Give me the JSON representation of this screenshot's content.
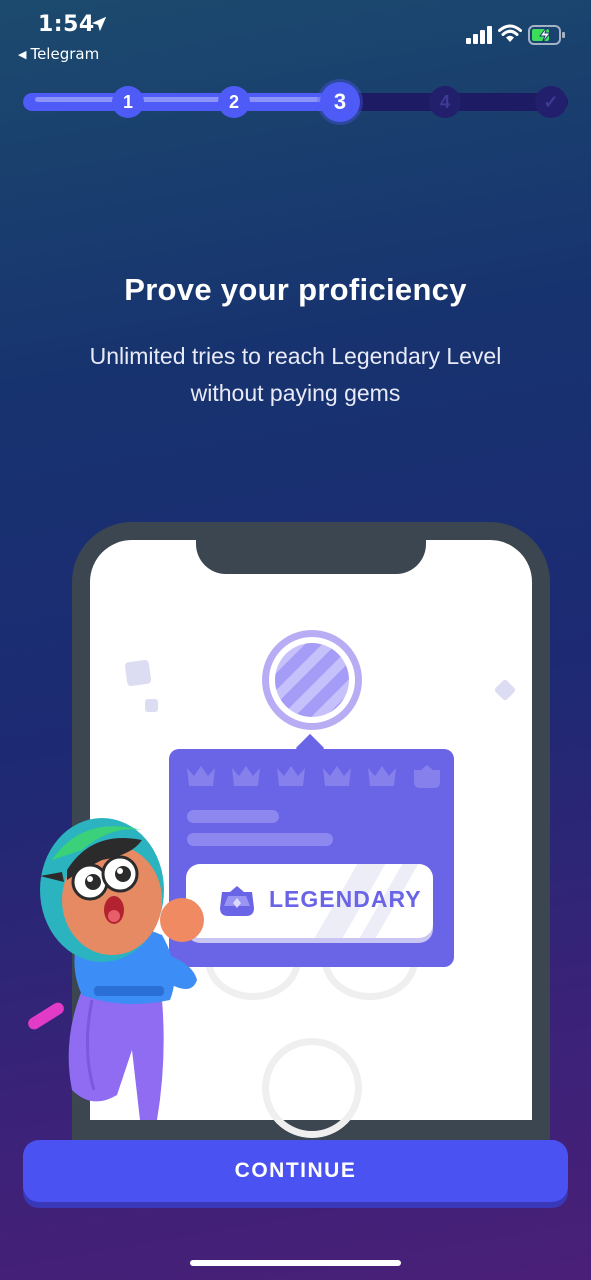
{
  "status_bar": {
    "time": "1:54",
    "back_app": "Telegram",
    "back_arrow": "◀",
    "icons": [
      "location-arrow-icon",
      "signal-icon",
      "wifi-icon",
      "battery-charging-icon"
    ]
  },
  "progress": {
    "current_step": 3,
    "steps": [
      {
        "label": "1",
        "state": "done"
      },
      {
        "label": "2",
        "state": "done"
      },
      {
        "label": "3",
        "state": "current"
      },
      {
        "label": "4",
        "state": "todo"
      },
      {
        "label": "✓",
        "state": "todo"
      }
    ]
  },
  "content": {
    "title": "Prove your proficiency",
    "subtitle_line1": "Unlimited tries to reach Legendary Level",
    "subtitle_line2": "without paying gems"
  },
  "illustration": {
    "badge_label": "LEGENDARY",
    "icons": [
      "crown-icon",
      "trophy-icon",
      "mascot-illustration"
    ]
  },
  "footer": {
    "continue_label": "CONTINUE"
  },
  "colors": {
    "accent": "#4a53f2",
    "popup": "#6a64e6",
    "step_inactive": "#221f6c"
  }
}
